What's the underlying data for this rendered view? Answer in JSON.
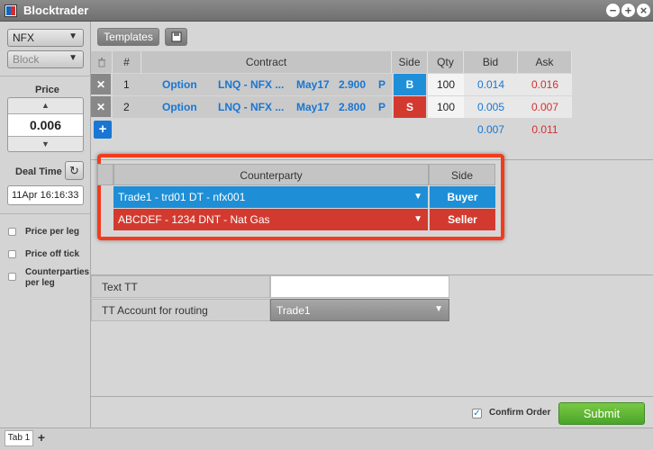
{
  "window": {
    "title": "Blocktrader",
    "buttons": [
      "minimize",
      "maximize",
      "close"
    ]
  },
  "left_panel": {
    "exchange_dropdown": "NFX",
    "type_dropdown": "Block",
    "price_label": "Price",
    "price_value": "0.006",
    "deal_time_label": "Deal Time",
    "deal_time_value": "11Apr 16:16:33",
    "options": [
      {
        "label": "Price per leg",
        "checked": false
      },
      {
        "label": "Price off tick",
        "checked": false
      },
      {
        "label": "Counterparties per leg",
        "checked": false
      }
    ]
  },
  "toolbar": {
    "templates_label": "Templates",
    "save_icon": "save-icon"
  },
  "legs": {
    "headers": {
      "num": "#",
      "contract": "Contract",
      "side": "Side",
      "qty": "Qty",
      "bid": "Bid",
      "ask": "Ask"
    },
    "rows": [
      {
        "num": "1",
        "type": "Option",
        "name": "LNQ - NFX ...",
        "month": "May17",
        "strike": "2.900",
        "cp": "P",
        "side": "B",
        "qty": "100",
        "bid": "0.014",
        "ask": "0.016"
      },
      {
        "num": "2",
        "type": "Option",
        "name": "LNQ - NFX ...",
        "month": "May17",
        "strike": "2.800",
        "cp": "P",
        "side": "S",
        "qty": "100",
        "bid": "0.005",
        "ask": "0.007"
      }
    ],
    "total": {
      "bid": "0.007",
      "ask": "0.011"
    }
  },
  "counterparties": {
    "headers": {
      "counterparty": "Counterparty",
      "side": "Side"
    },
    "rows": [
      {
        "name": "Trade1 - trd01 DT - nfx001",
        "side": "Buyer",
        "color": "#1e8fd6"
      },
      {
        "name": "ABCDEF - 1234 DNT - Nat Gas",
        "side": "Seller",
        "color": "#d33a2f"
      }
    ]
  },
  "text_tt": {
    "text_label": "Text TT",
    "text_value": "",
    "routing_label": "TT Account for routing",
    "routing_value": "Trade1"
  },
  "footer": {
    "confirm_label": "Confirm Order",
    "confirm_checked": true,
    "submit_label": "Submit"
  },
  "tabs": [
    {
      "label": "Tab 1"
    }
  ],
  "colors": {
    "buy": "#1f8fd8",
    "sell": "#d33a2f",
    "bid_text": "#1976d2",
    "ask_text": "#d32f2f",
    "submit": "#5cb833",
    "highlight": "#f23c1d"
  }
}
